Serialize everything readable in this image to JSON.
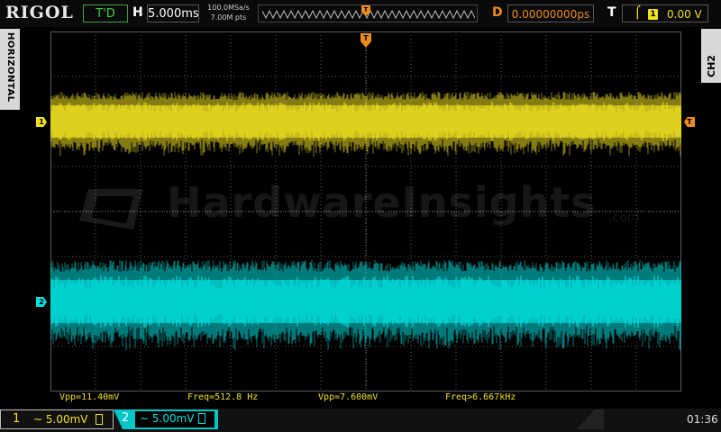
{
  "top": {
    "brand": "RIGOL",
    "run_status": "T'D",
    "h_label": "H",
    "timebase": "5.000ms",
    "sample_rate": "100.0MSa/s",
    "memory_depth": "7.00M pts",
    "d_label": "D",
    "trigger_delay": "0.00000000ps",
    "t_label": "T",
    "trigger_source": "1",
    "trigger_level": "0.00 V"
  },
  "side": {
    "left_label": "HORIZONTAL",
    "right_label": "CH2"
  },
  "watermark": {
    "text": "HardwareInsights",
    "suffix": ".com"
  },
  "markers": {
    "ch1": "1",
    "ch2": "2",
    "trigger_level": "T",
    "trigger_pos": "T"
  },
  "measurements": [
    {
      "text": "Vpp=11.40mV",
      "color": "#f0e020"
    },
    {
      "text": "Freq=512.8 Hz",
      "color": "#f0e020"
    },
    {
      "text": "Vpp=7.600mV",
      "color": "#f0e020"
    },
    {
      "text": "Freq>6.667kHz",
      "color": "#f0e020"
    }
  ],
  "channels": [
    {
      "num": "1",
      "coupling": "~",
      "scale": "5.00mV",
      "color": "#f0e020"
    },
    {
      "num": "2",
      "coupling": "~",
      "scale": "5.00mV",
      "color": "#00e0e0"
    }
  ],
  "clock": "01:36",
  "colors": {
    "ch1": "#f0e020",
    "ch2": "#00e0e0",
    "trigger": "#f08c1e",
    "grid": "#5a5a5a"
  }
}
